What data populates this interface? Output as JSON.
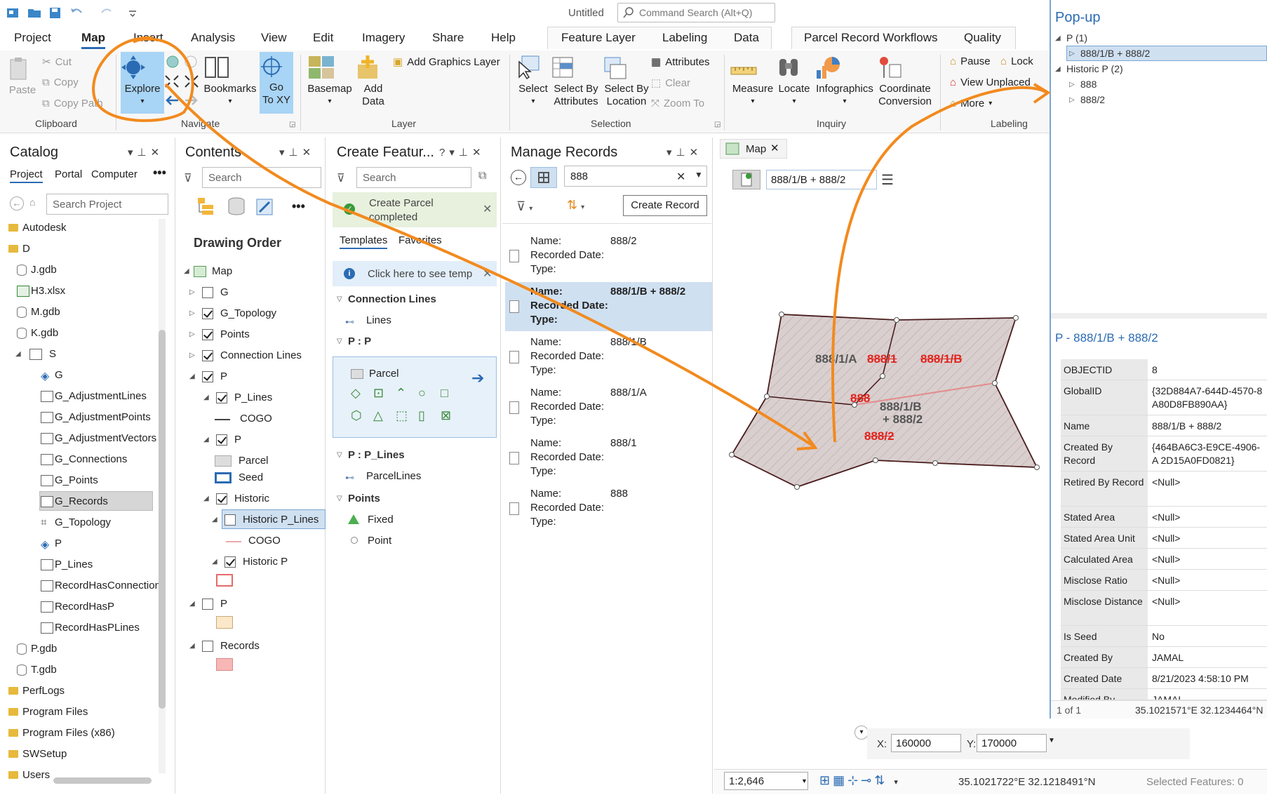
{
  "titlebar": {
    "doc_title": "Untitled",
    "command_search_placeholder": "Command Search (Alt+Q)"
  },
  "ribbon_tabs": [
    "Project",
    "Map",
    "Insert",
    "Analysis",
    "View",
    "Edit",
    "Imagery",
    "Share",
    "Help",
    "Feature Layer",
    "Labeling",
    "Data",
    "Parcel Record Workflows",
    "Quality"
  ],
  "active_tab": "Map",
  "ribbon": {
    "clipboard": {
      "paste": "Paste",
      "cut": "Cut",
      "copy": "Copy",
      "copy_path": "Copy Path",
      "label": "Clipboard"
    },
    "navigate": {
      "explore": "Explore",
      "bookmarks": "Bookmarks",
      "goto": "Go\nTo XY",
      "label": "Navigate"
    },
    "layer": {
      "basemap": "Basemap",
      "add_data": "Add\nData",
      "add_graphics": "Add Graphics Layer",
      "label": "Layer"
    },
    "selection": {
      "select": "Select",
      "select_by_attributes": "Select By\nAttributes",
      "select_by_location": "Select By\nLocation",
      "attributes": "Attributes",
      "clear": "Clear",
      "zoom_to": "Zoom To",
      "label": "Selection"
    },
    "inquiry": {
      "measure": "Measure",
      "locate": "Locate",
      "infographics": "Infographics",
      "coordinate_conversion": "Coordinate\nConversion",
      "label": "Inquiry"
    },
    "labeling": {
      "pause": "Pause",
      "lock": "Lock",
      "view_unplaced": "View Unplaced",
      "more": "More",
      "label": "Labeling"
    }
  },
  "catalog": {
    "title": "Catalog",
    "tabs": [
      "Project",
      "Portal",
      "Computer"
    ],
    "search_placeholder": "Search Project",
    "items": [
      "Autodesk",
      "D",
      "J.gdb",
      "H3.xlsx",
      "M.gdb",
      "K.gdb",
      "S",
      "G",
      "G_AdjustmentLines",
      "G_AdjustmentPoints",
      "G_AdjustmentVectors",
      "G_Connections",
      "G_Points",
      "G_Records",
      "G_Topology",
      "P",
      "P_Lines",
      "RecordHasConnections",
      "RecordHasP",
      "RecordHasPLines",
      "P.gdb",
      "T.gdb",
      "PerfLogs",
      "Program Files",
      "Program Files (x86)",
      "SWSetup",
      "Users"
    ]
  },
  "contents": {
    "title": "Contents",
    "search_placeholder": "Search",
    "drawing_order": "Drawing Order",
    "layers": [
      "Map",
      "G",
      "G_Topology",
      "Points",
      "Connection Lines",
      "P",
      "P_Lines",
      "COGO",
      "P",
      "Parcel",
      "Seed",
      "Historic",
      "Historic P_Lines",
      "COGO",
      "Historic P",
      "P",
      "Records"
    ]
  },
  "create_features": {
    "title": "Create Featur...",
    "help": "?",
    "notice": "Create Parcel completed",
    "tabs": [
      "Templates",
      "Favorites"
    ],
    "info": "Click here to see temp",
    "groups": [
      "Connection Lines",
      "P : P",
      "P : P_Lines",
      "Points"
    ],
    "items": [
      "Lines",
      "Parcel",
      "ParcelLines",
      "Fixed",
      "Point"
    ]
  },
  "manage_records": {
    "title": "Manage Records",
    "search_value": "888",
    "create_button": "Create Record",
    "field_labels": {
      "name": "Name:",
      "recorded": "Recorded Date:",
      "type": "Type:"
    },
    "records": [
      {
        "name": "888/2"
      },
      {
        "name": "888/1/B + 888/2"
      },
      {
        "name": "888/1/B"
      },
      {
        "name": "888/1/A"
      },
      {
        "name": "888/1"
      },
      {
        "name": "888"
      }
    ]
  },
  "map": {
    "tab": "Map",
    "active_record": "888/1/B + 888/2",
    "scale": "1:2,646",
    "coords": "35.1021722°E 32.1218491°N",
    "selected": "Selected Features: 0",
    "goto_x_label": "X:",
    "goto_x": "160000",
    "goto_y_label": "Y:",
    "goto_y": "170000",
    "unit": "m",
    "labels": {
      "a": "888/1/A",
      "b": "888/1",
      "c": "888/1/B",
      "d": "888",
      "e": "888/1/B",
      "f": "+ 888/2",
      "g": "888/2"
    }
  },
  "popup": {
    "title": "Pop-up",
    "tree": [
      {
        "label": "P (1)"
      },
      {
        "label": "888/1/B + 888/2"
      },
      {
        "label": "Historic P (2)"
      },
      {
        "label": "888"
      },
      {
        "label": "888/2"
      }
    ],
    "subtitle": "P - 888/1/B + 888/2",
    "nav": "1 of 1",
    "coords": "35.1021571°E 32.1234464°N",
    "fields": [
      {
        "k": "OBJECTID",
        "v": "8"
      },
      {
        "k": "GlobalID",
        "v": "{32D884A7-644D-4570-8 A80D8FB890AA}"
      },
      {
        "k": "Name",
        "v": "888/1/B + 888/2"
      },
      {
        "k": "Created By Record",
        "v": "{464BA6C3-E9CE-4906-A 2D15A0FD0821}"
      },
      {
        "k": "Retired By Record",
        "v": "<Null>"
      },
      {
        "k": "Stated Area",
        "v": "<Null>"
      },
      {
        "k": "Stated Area Unit",
        "v": "<Null>"
      },
      {
        "k": "Calculated Area",
        "v": "<Null>"
      },
      {
        "k": "Misclose Ratio",
        "v": "<Null>"
      },
      {
        "k": "Misclose Distance",
        "v": "<Null>"
      },
      {
        "k": "Is Seed",
        "v": "No"
      },
      {
        "k": "Created By",
        "v": "JAMAL"
      },
      {
        "k": "Created Date",
        "v": "8/21/2023 4:58:10 PM"
      },
      {
        "k": "Modified By",
        "v": "JAMAL"
      }
    ]
  },
  "colors": {
    "accent": "#2b6bb3",
    "annotation": "#f28a1e",
    "label_red": "#e0261f",
    "parcel_fill": "#d9cfcf",
    "selected": "#cfe0f1"
  }
}
